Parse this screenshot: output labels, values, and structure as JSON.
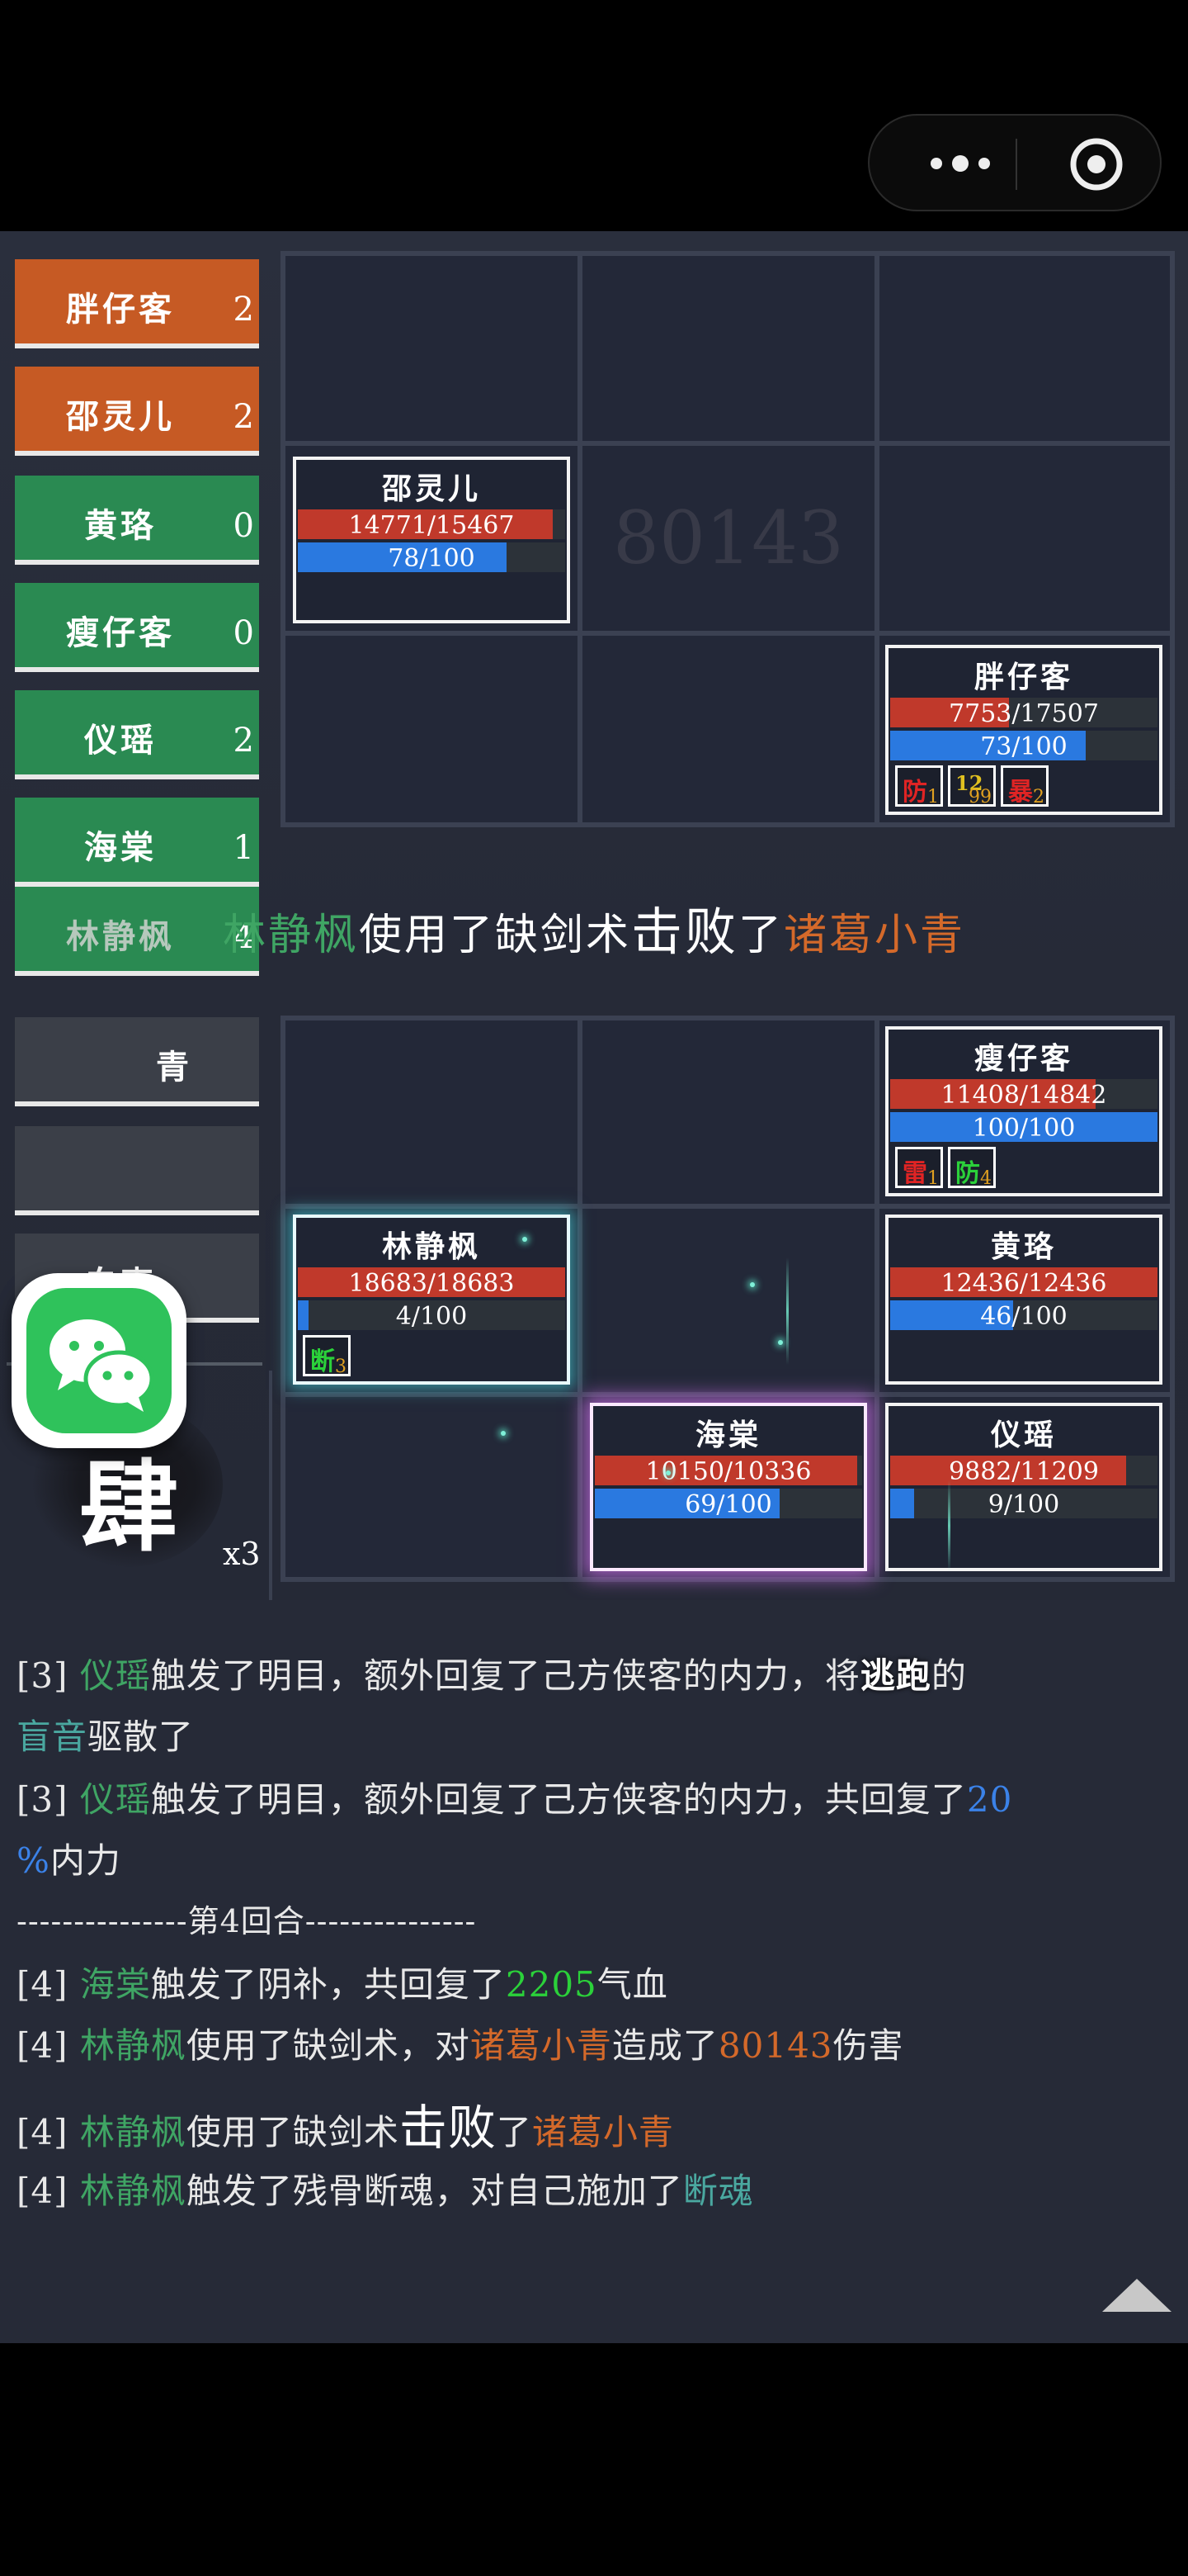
{
  "side_list": [
    {
      "name": "胖仔客",
      "count": "2",
      "side": "enemy"
    },
    {
      "name": "邵灵儿",
      "count": "2",
      "side": "enemy"
    },
    {
      "name": "黄珞",
      "count": "0",
      "side": "ally"
    },
    {
      "name": "瘦仔客",
      "count": "0",
      "side": "ally"
    },
    {
      "name": "仪瑶",
      "count": "2",
      "side": "ally"
    },
    {
      "name": "海棠",
      "count": "1",
      "side": "ally"
    },
    {
      "name": "林静枫",
      "count": "4",
      "side": "ally"
    },
    {
      "name": "青",
      "count": "",
      "side": "dead"
    },
    {
      "name": "",
      "count": "",
      "side": "dead"
    },
    {
      "name": "白克",
      "count": "",
      "side": "dead"
    }
  ],
  "round": {
    "char": "肆",
    "multiplier": "x3"
  },
  "ghost_damage": "80143",
  "enemy_cards": [
    {
      "name": "邵灵儿",
      "hp": "14771/15467",
      "hp_frac": 0.955,
      "mp": "78/100",
      "mp_frac": 0.78,
      "buffs": []
    },
    {
      "name": "胖仔客",
      "hp": "7753/17507",
      "hp_frac": 0.443,
      "mp": "73/100",
      "mp_frac": 0.73,
      "buffs": [
        {
          "label": "防",
          "num": "1",
          "color": "#e02424"
        },
        {
          "label": "12",
          "num": "99",
          "color": "#2bd13a"
        },
        {
          "label": "暴",
          "num": "2",
          "color": "#e02424"
        }
      ]
    }
  ],
  "announce": {
    "actor": "林静枫",
    "mid1": "使用了缺剑术",
    "verb": "击败",
    "mid2": "了",
    "target": "诸葛小青"
  },
  "ally_cards": [
    {
      "name": "瘦仔客",
      "hp": "11408/14842",
      "hp_frac": 0.769,
      "mp": "100/100",
      "mp_frac": 1.0,
      "buffs": [
        {
          "label": "雷",
          "num": "1",
          "color": "#e02424"
        },
        {
          "label": "防",
          "num": "4",
          "color": "#2bd13a"
        }
      ]
    },
    {
      "name": "林静枫",
      "hp": "18683/18683",
      "hp_frac": 1.0,
      "mp": "4/100",
      "mp_frac": 0.04,
      "buffs": [
        {
          "label": "断",
          "num": "3",
          "color": "#2bd13a"
        }
      ]
    },
    {
      "name": "黄珞",
      "hp": "12436/12436",
      "hp_frac": 1.0,
      "mp": "46/100",
      "mp_frac": 0.46,
      "buffs": []
    },
    {
      "name": "海棠",
      "hp": "10150/10336",
      "hp_frac": 0.982,
      "mp": "69/100",
      "mp_frac": 0.69,
      "buffs": []
    },
    {
      "name": "仪瑶",
      "hp": "9882/11209",
      "hp_frac": 0.882,
      "mp": "9/100",
      "mp_frac": 0.09,
      "buffs": []
    }
  ],
  "log": {
    "l1": {
      "tag": "[3]",
      "actor": "仪瑶",
      "text": "触发了明目，额外回复了己方侠客的内力，将",
      "hl": "逃跑",
      "end": "的"
    },
    "l1b": {
      "buff": "盲音",
      "text": "驱散了"
    },
    "l2": {
      "tag": "[3]",
      "actor": "仪瑶",
      "text": "触发了明目，额外回复了己方侠客的内力，共回复了",
      "val": "20"
    },
    "l2b": {
      "val": "%",
      "text": "内力"
    },
    "round_sep": "---------------第4回合---------------",
    "l3": {
      "tag": "[4]",
      "actor": "海棠",
      "text": "触发了阴补，共回复了",
      "val": "2205",
      "end": "气血"
    },
    "l4": {
      "tag": "[4]",
      "actor": "林静枫",
      "text": "使用了缺剑术，对",
      "target": "诸葛小青",
      "mid": "造成了",
      "val": "80143",
      "end": "伤害"
    },
    "l5": {
      "tag": "[4]",
      "actor": "林静枫",
      "text": "使用了缺剑术",
      "verb": "击败",
      "mid": "了",
      "target": "诸葛小青"
    },
    "l6": {
      "tag": "[4]",
      "actor": "林静枫",
      "text": "触发了残骨断魂，对自己施加了",
      "buff": "断魂"
    }
  }
}
